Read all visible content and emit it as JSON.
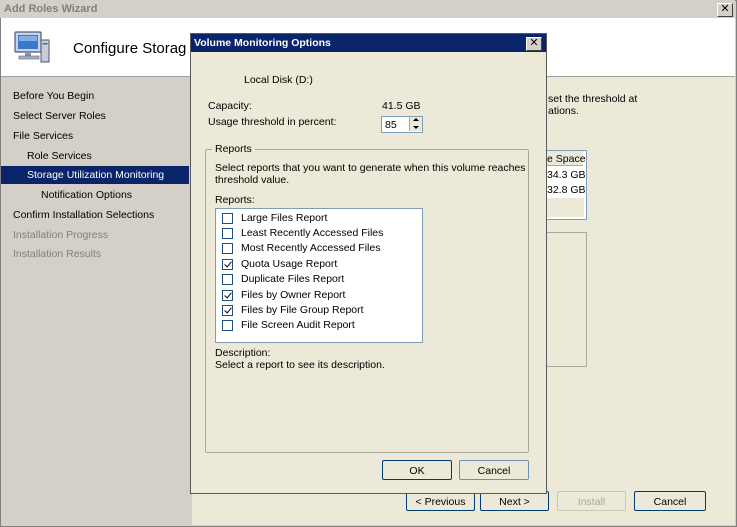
{
  "wizard": {
    "title": "Add Roles Wizard",
    "header_title": "Configure Storag",
    "close_glyph": "✕",
    "nav": [
      {
        "label": "Before You Begin",
        "state": "normal"
      },
      {
        "label": "Select Server Roles",
        "state": "normal"
      },
      {
        "label": "File Services",
        "state": "normal"
      },
      {
        "label": "Role Services",
        "state": "normal"
      },
      {
        "label": "Storage Utilization Monitoring",
        "state": "selected"
      },
      {
        "label": "Notification Options",
        "state": "normal"
      },
      {
        "label": "Confirm Installation Selections",
        "state": "normal"
      },
      {
        "label": "Installation Progress",
        "state": "disabled"
      },
      {
        "label": "Installation Results",
        "state": "disabled"
      }
    ],
    "main": {
      "text_line1": "set the threshold at",
      "text_line2": "ations.",
      "column_header": "e Space",
      "rows": [
        "34.3 GB",
        "32.8 GB"
      ]
    },
    "buttons": {
      "previous": "< Previous",
      "next": "Next >",
      "install": "Install",
      "cancel": "Cancel"
    }
  },
  "dialog": {
    "title": "Volume Monitoring Options",
    "close_glyph": "✕",
    "volume_name": "Local Disk (D:)",
    "capacity_label": "Capacity:",
    "capacity_value": "41.5 GB",
    "threshold_label": "Usage threshold in percent:",
    "threshold_value": "85",
    "reports_group_label": "Reports",
    "reports_instruction_line1": "Select reports that you want to generate when this volume reaches",
    "reports_instruction_line2": "threshold value.",
    "reports_list_label": "Reports:",
    "reports": [
      {
        "label": "Large Files Report",
        "checked": false
      },
      {
        "label": "Least Recently Accessed Files",
        "checked": false
      },
      {
        "label": "Most Recently Accessed Files",
        "checked": false
      },
      {
        "label": "Quota Usage Report",
        "checked": true
      },
      {
        "label": "Duplicate Files Report",
        "checked": false
      },
      {
        "label": "Files by Owner Report",
        "checked": true
      },
      {
        "label": "Files by File Group Report",
        "checked": true
      },
      {
        "label": "File Screen Audit Report",
        "checked": false
      }
    ],
    "description_label": "Description:",
    "description_text": "Select a report to see its description.",
    "ok_label": "OK",
    "cancel_label": "Cancel"
  },
  "colors": {
    "selection": "#0a246a",
    "dialog_titlebar": "#0a246a",
    "window_bg": "#ece9d8"
  }
}
